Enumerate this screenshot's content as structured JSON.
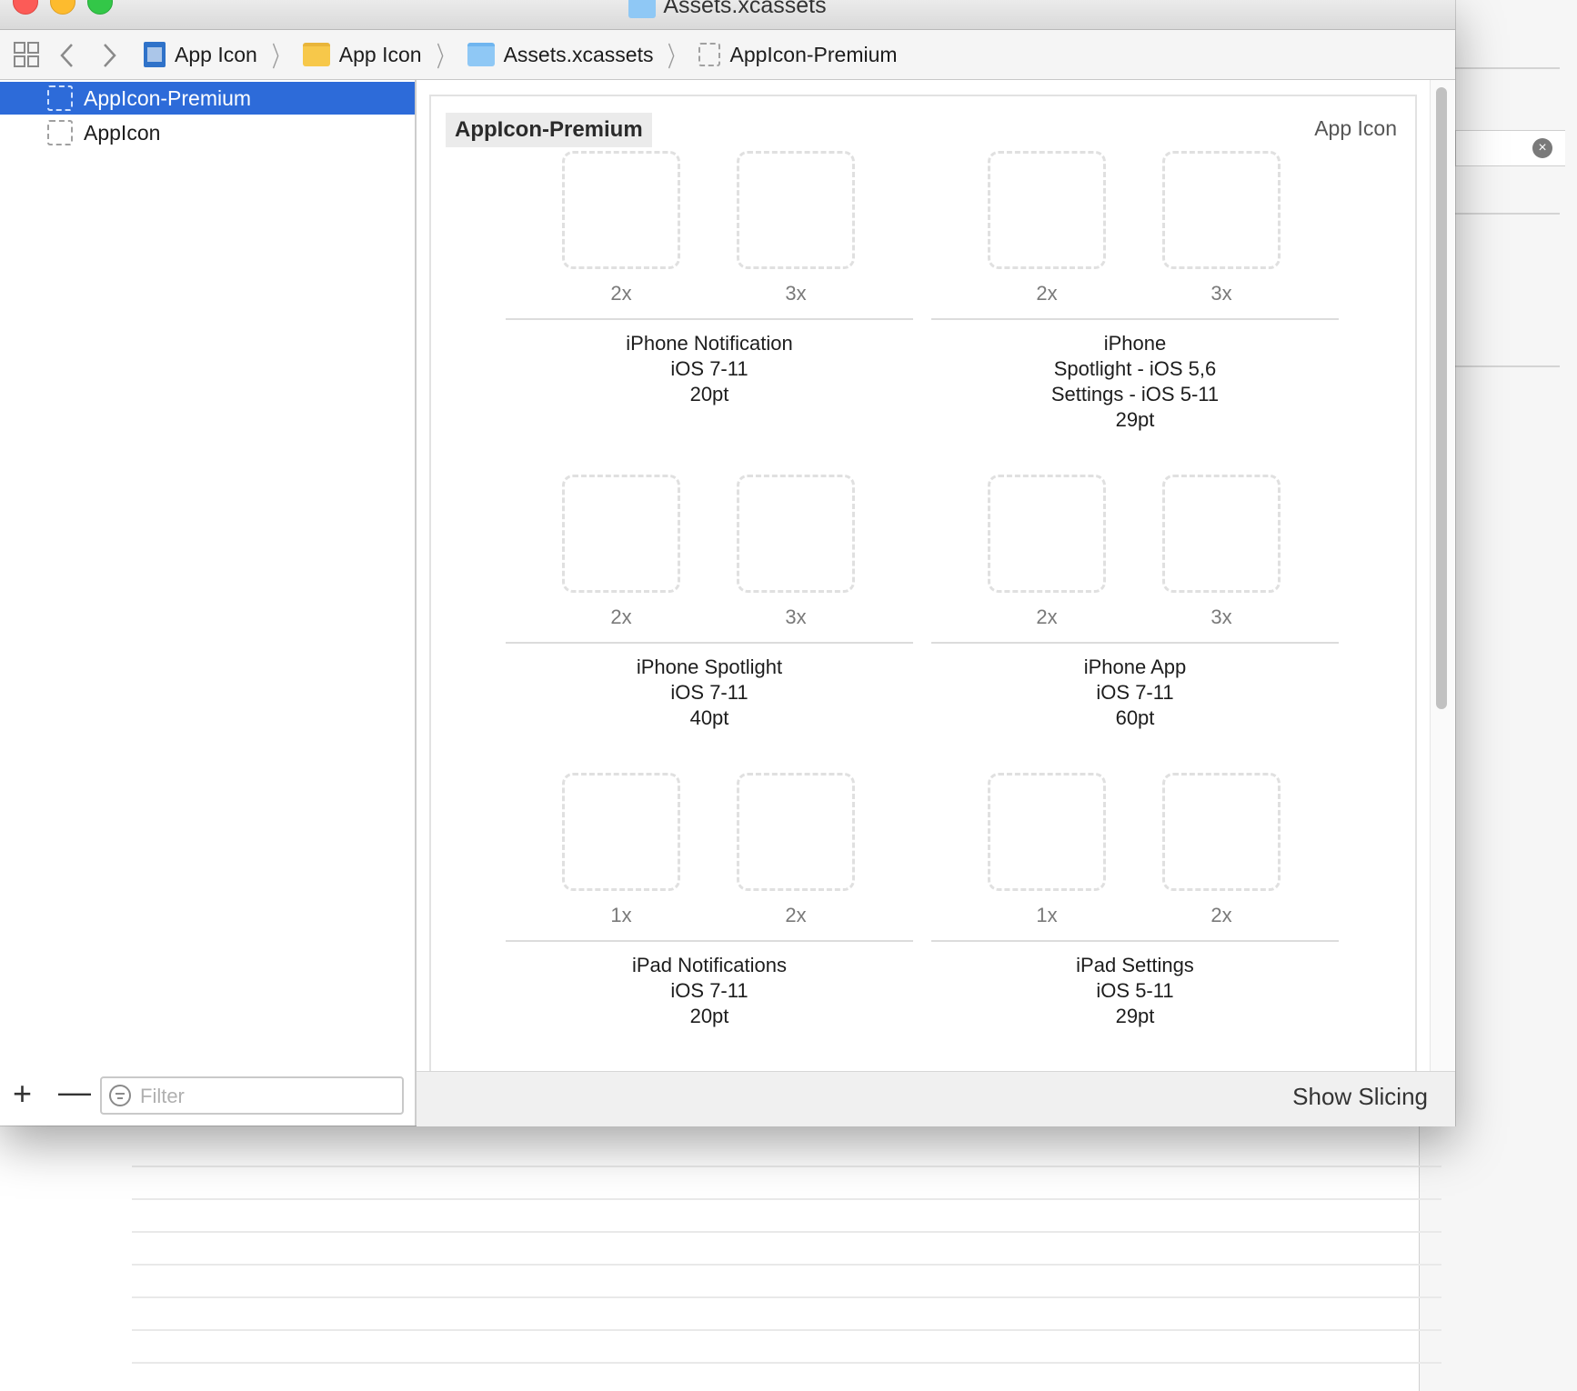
{
  "window": {
    "title": "Assets.xcassets"
  },
  "breadcrumbs": [
    {
      "label": "App Icon",
      "icon": "xcode-project-icon"
    },
    {
      "label": "App Icon",
      "icon": "folder-icon"
    },
    {
      "label": "Assets.xcassets",
      "icon": "asset-catalog-icon"
    },
    {
      "label": "AppIcon-Premium",
      "icon": "appicon-set-icon"
    }
  ],
  "sidebar": {
    "items": [
      {
        "label": "AppIcon-Premium",
        "selected": true
      },
      {
        "label": "AppIcon",
        "selected": false
      }
    ],
    "add_label": "+",
    "remove_label": "—",
    "filter_placeholder": "Filter"
  },
  "editor": {
    "set_name": "AppIcon-Premium",
    "set_type": "App Icon",
    "groups": [
      {
        "scales": [
          "2x",
          "3x"
        ],
        "lines": [
          "iPhone Notification",
          "iOS 7-11",
          "20pt"
        ]
      },
      {
        "scales": [
          "2x",
          "3x"
        ],
        "lines": [
          "iPhone",
          "Spotlight - iOS 5,6",
          "Settings - iOS 5-11",
          "29pt"
        ]
      },
      {
        "scales": [
          "2x",
          "3x"
        ],
        "lines": [
          "iPhone Spotlight",
          "iOS 7-11",
          "40pt"
        ]
      },
      {
        "scales": [
          "2x",
          "3x"
        ],
        "lines": [
          "iPhone App",
          "iOS 7-11",
          "60pt"
        ]
      },
      {
        "scales": [
          "1x",
          "2x"
        ],
        "lines": [
          "iPad Notifications",
          "iOS 7-11",
          "20pt"
        ]
      },
      {
        "scales": [
          "1x",
          "2x"
        ],
        "lines": [
          "iPad Settings",
          "iOS 5-11",
          "29pt"
        ]
      }
    ],
    "show_slicing_label": "Show Slicing"
  },
  "background_window": {
    "clear_icon": "×"
  }
}
